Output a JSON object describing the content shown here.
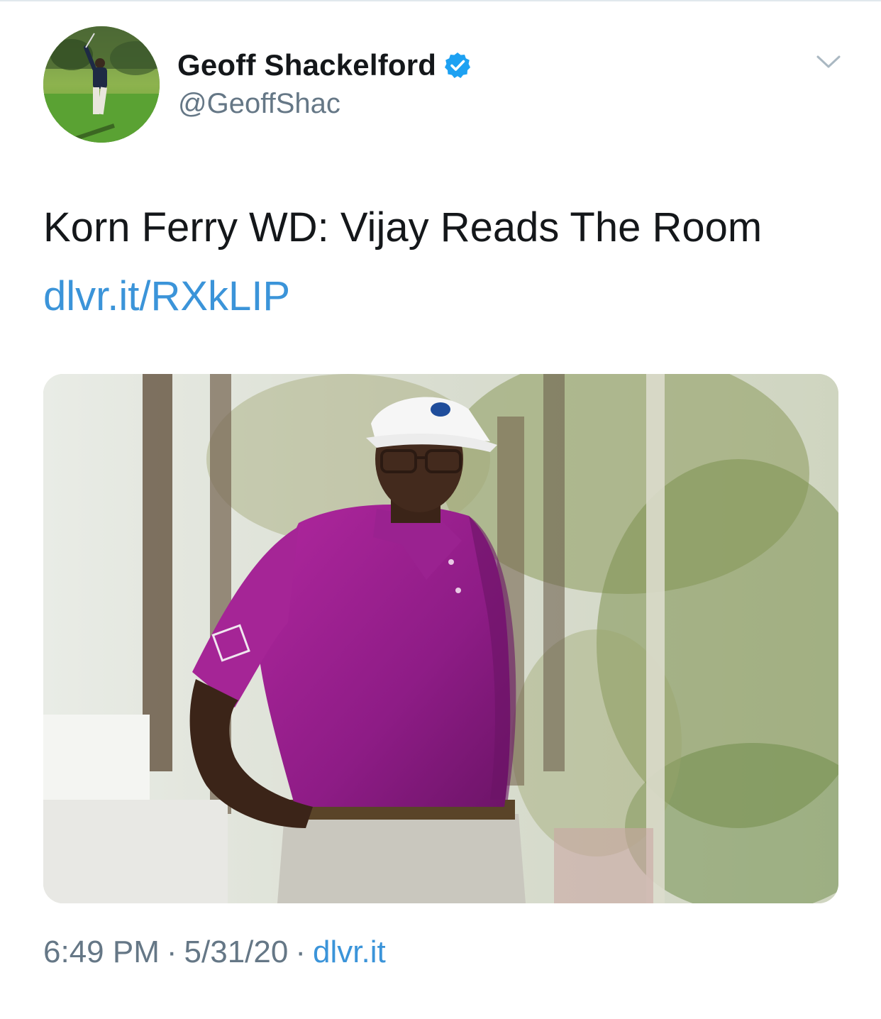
{
  "tweet": {
    "author": {
      "display_name": "Geoff Shackelford",
      "handle": "@GeoffShac",
      "verified": true,
      "avatar_icon": "avatar-golfer-photo"
    },
    "text": "Korn Ferry WD: Vijay Reads The Room",
    "link": "dlvr.it/RXkLIP",
    "media": {
      "description_icon": "golfer-photo"
    },
    "time": "6:49 PM",
    "date": "5/31/20",
    "source": "dlvr.it",
    "separator": "·"
  },
  "colors": {
    "link": "#3b94d9",
    "secondary_text": "#657786",
    "verified_badge": "#1da1f2",
    "primary_text": "#14171a"
  },
  "icons": {
    "verified": "verified-badge-icon",
    "caret": "chevron-down-icon"
  }
}
